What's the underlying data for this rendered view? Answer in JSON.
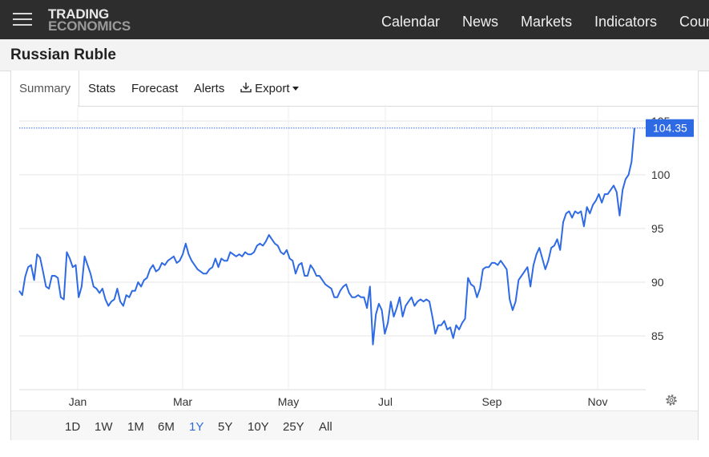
{
  "header": {
    "logo_line1": "TRADING",
    "logo_line2": "ECONOMICS",
    "nav": [
      "Calendar",
      "News",
      "Markets",
      "Indicators",
      "Countries"
    ]
  },
  "page": {
    "title": "Russian Ruble"
  },
  "tabs": {
    "summary": "Summary",
    "stats": "Stats",
    "forecast": "Forecast",
    "alerts": "Alerts",
    "export": "Export"
  },
  "ranges": {
    "items": [
      "1D",
      "1W",
      "1M",
      "6M",
      "1Y",
      "5Y",
      "10Y",
      "25Y",
      "All"
    ],
    "active": "1Y"
  },
  "icons": {
    "menu": "hamburger-menu-icon",
    "export": "download-icon",
    "settings": "gear-icon"
  },
  "colors": {
    "line": "#2f6ae5",
    "last_price_bg": "#2f6ae5",
    "active_range": "#2e6bd9"
  },
  "chart_data": {
    "type": "line",
    "x_tick_labels": [
      "Jan",
      "Mar",
      "May",
      "Jul",
      "Sep",
      "Nov"
    ],
    "y_tick_labels": [
      "85",
      "90",
      "95",
      "100",
      "105"
    ],
    "ylim": [
      80,
      106
    ],
    "grid": true,
    "last_value": 104.35,
    "last_value_label": "104.35",
    "series": [
      {
        "values": [
          89.2,
          88.8,
          90.5,
          91.4,
          91.6,
          90.2,
          92.6,
          92.3,
          91.0,
          89.6,
          89.4,
          90.6,
          90.6,
          90.4,
          88.6,
          88.4,
          92.8,
          92.2,
          91.4,
          91.6,
          88.6,
          89.6,
          92.4,
          91.6,
          90.8,
          89.6,
          89.4,
          89.0,
          89.4,
          88.4,
          87.8,
          88.2,
          88.4,
          89.4,
          88.2,
          87.8,
          88.8,
          88.6,
          89.2,
          89.2,
          90.0,
          89.6,
          90.2,
          90.4,
          91.2,
          91.6,
          91.0,
          91.2,
          91.8,
          91.6,
          92.0,
          92.2,
          92.4,
          91.8,
          92.0,
          92.6,
          93.6,
          92.6,
          92.0,
          91.6,
          91.2,
          91.0,
          90.8,
          90.8,
          91.2,
          91.4,
          92.2,
          91.4,
          92.2,
          92.0,
          92.0,
          92.8,
          92.6,
          92.4,
          92.6,
          92.4,
          92.8,
          92.6,
          92.6,
          92.8,
          93.4,
          93.6,
          93.4,
          93.8,
          94.4,
          94.0,
          93.6,
          93.4,
          92.8,
          92.6,
          93.0,
          92.2,
          92.0,
          90.8,
          91.6,
          91.8,
          90.6,
          90.6,
          91.6,
          91.2,
          90.6,
          90.6,
          90.2,
          89.8,
          89.6,
          89.4,
          88.6,
          88.6,
          89.2,
          89.6,
          89.8,
          89.0,
          88.6,
          88.6,
          88.8,
          88.6,
          88.6,
          87.6,
          89.6,
          84.2,
          87.0,
          88.0,
          87.4,
          85.2,
          86.2,
          88.2,
          86.8,
          87.6,
          88.6,
          86.8,
          87.8,
          88.2,
          88.6,
          87.8,
          88.2,
          88.4,
          88.2,
          88.4,
          88.2,
          86.8,
          85.2,
          86.0,
          86.0,
          86.4,
          85.6,
          85.8,
          84.8,
          86.0,
          85.6,
          86.2,
          86.6,
          90.4,
          89.8,
          89.6,
          88.6,
          89.4,
          91.2,
          91.4,
          91.4,
          91.8,
          91.8,
          91.6,
          92.0,
          91.6,
          91.2,
          88.4,
          87.4,
          88.2,
          90.2,
          90.6,
          91.0,
          91.4,
          89.6,
          91.6,
          92.6,
          93.2,
          92.2,
          91.2,
          92.0,
          93.2,
          93.4,
          94.0,
          93.0,
          95.6,
          96.4,
          96.6,
          96.0,
          96.6,
          96.4,
          96.6,
          95.2,
          97.0,
          96.4,
          97.2,
          97.6,
          98.2,
          97.4,
          98.2,
          98.2,
          98.6,
          99.0,
          98.4,
          96.2,
          98.6,
          99.6,
          100.0,
          101.2,
          104.35
        ]
      }
    ]
  }
}
